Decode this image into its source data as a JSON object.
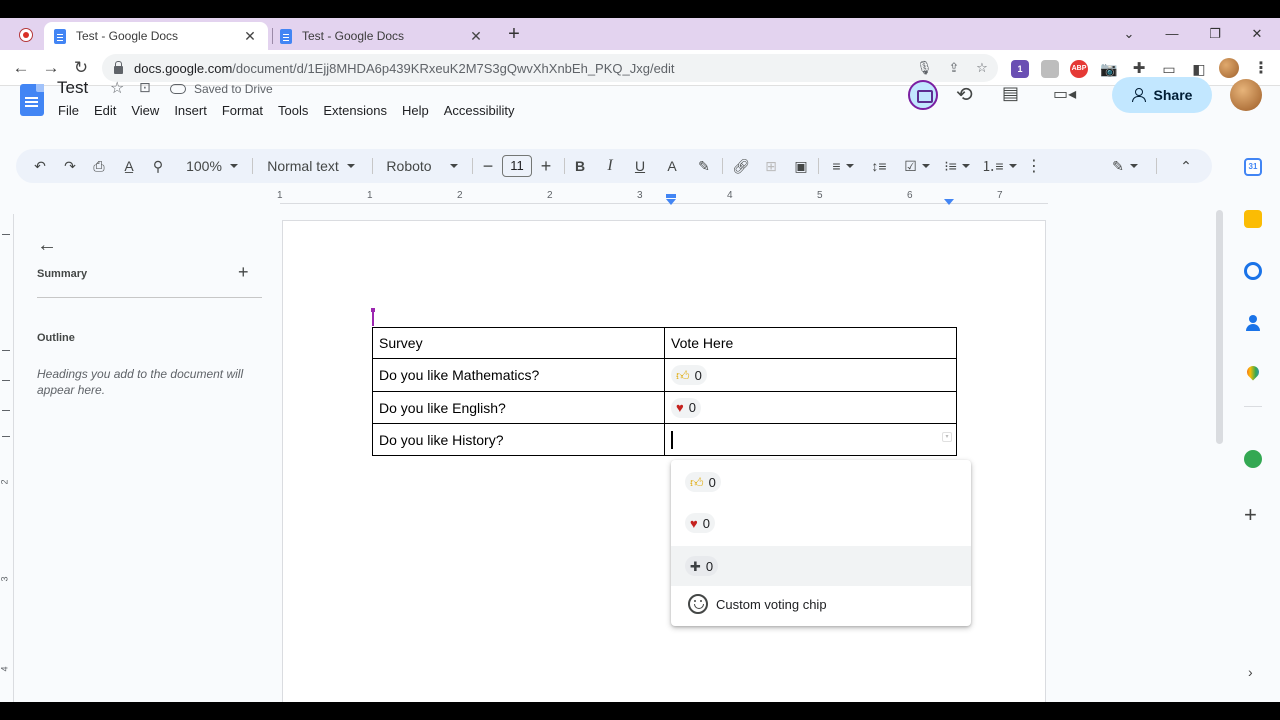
{
  "browser": {
    "tabs": [
      {
        "title": "Test - Google Docs",
        "active": true
      },
      {
        "title": "Test - Google Docs",
        "active": false
      }
    ],
    "close_glyph": "✕",
    "new_tab_glyph": "+",
    "url_host": "docs.google.com",
    "url_path": "/document/d/1Ejj8MHDA6p439KRxeuK2M7S3gQwvXhXnbEh_PKQ_Jxg/edit",
    "extension_badge": "1",
    "abp_label": "ABP"
  },
  "docs": {
    "title": "Test",
    "save_status": "Saved to Drive",
    "menus": [
      "File",
      "Edit",
      "View",
      "Insert",
      "Format",
      "Tools",
      "Extensions",
      "Help",
      "Accessibility"
    ],
    "share_label": "Share",
    "colors": {
      "accent": "#c2e7ff",
      "toolbar_bg": "#edf2fa",
      "docs_blue": "#4285f4"
    }
  },
  "toolbar": {
    "zoom": "100%",
    "style": "Normal text",
    "font": "Roboto",
    "font_size": "11",
    "bold": "B",
    "italic": "I",
    "underline": "U",
    "text_color": "A"
  },
  "ruler": {
    "numbers": [
      "1",
      "1",
      "2",
      "3",
      "4",
      "5",
      "6",
      "7"
    ],
    "vertical_numbers": [
      "1",
      "1",
      "2",
      "3",
      "4"
    ]
  },
  "outline_panel": {
    "summary_label": "Summary",
    "summary_add": "+",
    "outline_label": "Outline",
    "hint": "Headings you add to the document will appear here."
  },
  "table": {
    "rows": [
      {
        "question": "Survey",
        "vote": "Vote Here",
        "chip": null
      },
      {
        "question": "Do you like Mathematics?",
        "chip": {
          "icon": "thumbs-up",
          "count": "0"
        }
      },
      {
        "question": "Do you like English?",
        "chip": {
          "icon": "heart",
          "count": "0"
        }
      },
      {
        "question": "Do you like History?",
        "chip": null
      }
    ]
  },
  "dropdown": {
    "items": [
      {
        "icon": "thumbs-up",
        "count": "0"
      },
      {
        "icon": "heart",
        "count": "0"
      },
      {
        "icon": "plus",
        "count": "0"
      }
    ],
    "custom_label": "Custom voting chip"
  },
  "side_panel": {
    "icons": [
      "calendar-icon",
      "keep-icon",
      "tasks-icon",
      "contacts-icon",
      "maps-icon",
      "addon-icon"
    ],
    "calendar_day": "31",
    "add_glyph": "+",
    "chevron_glyph": "›"
  }
}
